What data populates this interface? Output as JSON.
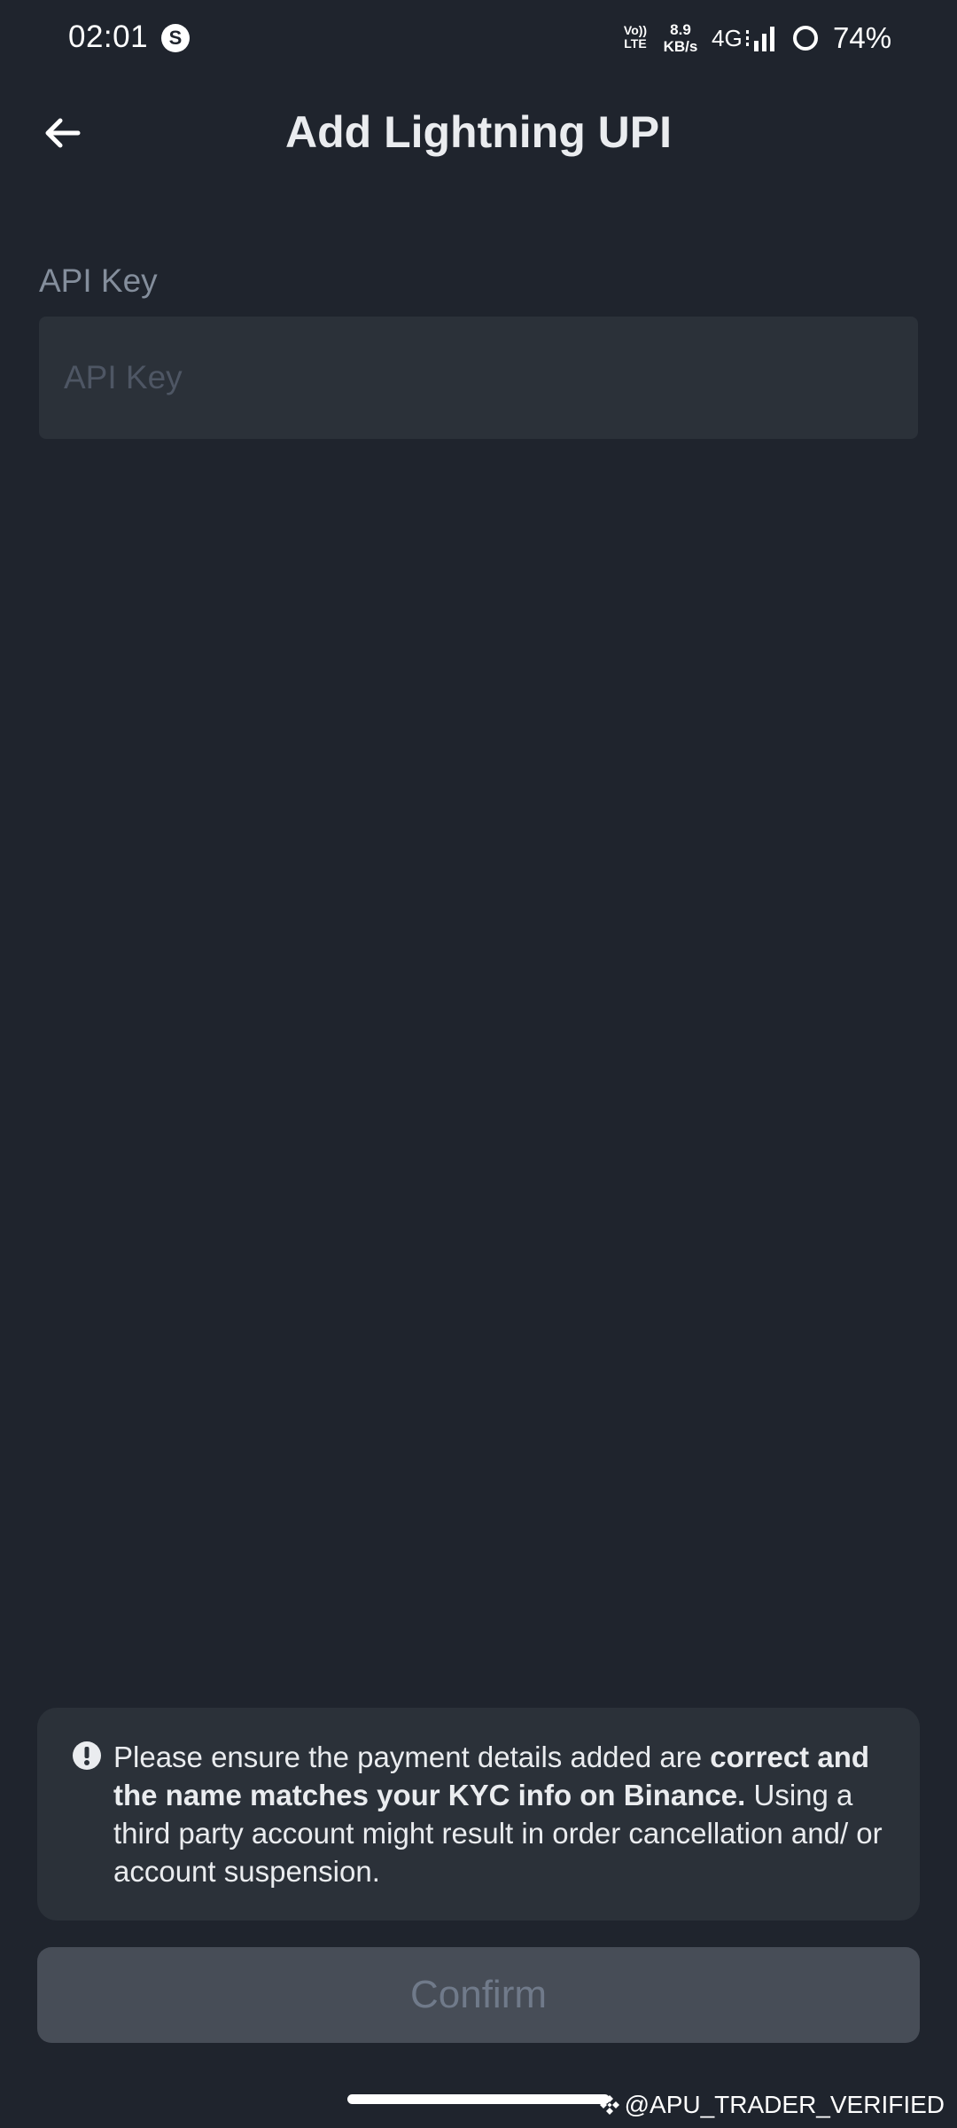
{
  "status_bar": {
    "time": "02:01",
    "app_icon_glyph": "S",
    "volte_top": "Vo))",
    "volte_bottom": "LTE",
    "speed_value": "8.9",
    "speed_unit": "KB/s",
    "network": "4G",
    "battery": "74%",
    "icons": [
      "skype-icon",
      "volte-icon",
      "signal-icon",
      "battery-ring-icon"
    ]
  },
  "header": {
    "title": "Add Lightning UPI",
    "back_icon": "arrow-left-icon"
  },
  "form": {
    "api_key": {
      "label": "API Key",
      "placeholder": "API Key",
      "value": ""
    }
  },
  "notice": {
    "icon": "exclamation-circle-icon",
    "text_normal_1": "Please ensure the payment details added are ",
    "text_bold": "correct and the name matches your KYC info on Binance.",
    "text_normal_2": " Using a third party account might result in order cancellation and/ or account suspension."
  },
  "confirm": {
    "label": "Confirm",
    "enabled": false
  },
  "watermark": {
    "text": "@APU_TRADER_VERIFIED",
    "icon": "binance-logo-icon"
  },
  "colors": {
    "background": "#1f242d",
    "input_background": "#2b3139",
    "button_disabled": "#474d57",
    "button_text_disabled": "#707a8a",
    "label_grey": "#848e9c",
    "text_primary": "#eaecef"
  }
}
